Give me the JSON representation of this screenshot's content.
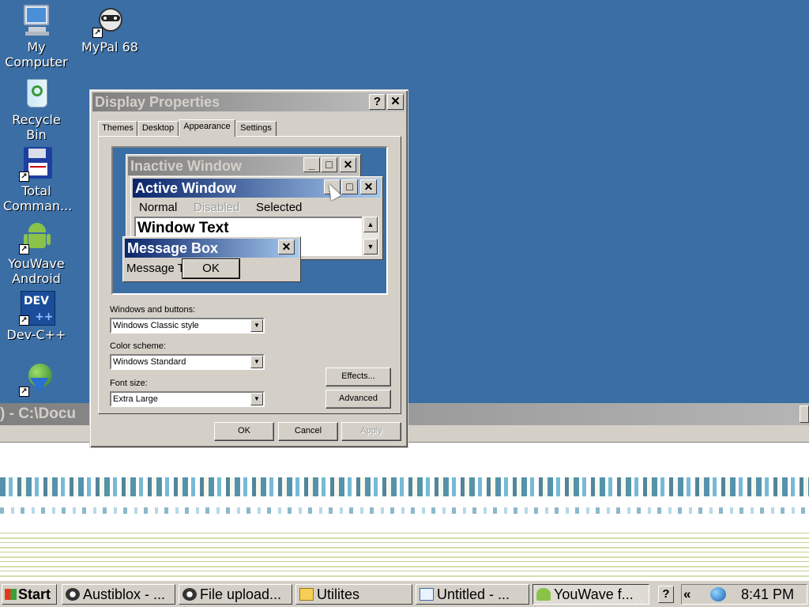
{
  "desktop": {
    "icons": [
      {
        "label": "My\nComputer",
        "icon": "my-computer-icon"
      },
      {
        "label": "MyPal 68",
        "icon": "mypal-raccoon-icon"
      },
      {
        "label": "Recycle Bin",
        "icon": "recycle-bin-icon"
      },
      {
        "label": "Total\nComman...",
        "icon": "floppy-disk-icon"
      },
      {
        "label": "YouWave\nAndroid",
        "icon": "android-icon"
      },
      {
        "label": "Dev-C++",
        "icon": "devcpp-icon"
      },
      {
        "label": "",
        "icon": "internet-download-icon"
      }
    ],
    "background_color": "#3a6ea5"
  },
  "background_window": {
    "title": ") - C:\\Docu"
  },
  "dialog": {
    "title": "Display Properties",
    "help_button": "?",
    "close_button": "✕",
    "tabs": [
      "Themes",
      "Desktop",
      "Appearance",
      "Settings"
    ],
    "active_tab": "Appearance",
    "preview": {
      "inactive_title": "Inactive Window",
      "active_title": "Active Window",
      "menu_items": [
        "Normal",
        "Disabled",
        "Selected"
      ],
      "window_text": "Window Text",
      "message_box_title": "Message Box",
      "message_text": "Message Text",
      "ok_label": "OK"
    },
    "windows_and_buttons": {
      "label": "Windows and buttons:",
      "value": "Windows Classic style"
    },
    "color_scheme": {
      "label": "Color scheme:",
      "value": "Windows Standard"
    },
    "font_size": {
      "label": "Font size:",
      "value": "Extra Large"
    },
    "effects_label": "Effects...",
    "advanced_label": "Advanced",
    "ok_label": "OK",
    "cancel_label": "Cancel",
    "apply_label": "Apply"
  },
  "taskbar": {
    "start_label": "Start",
    "tasks": [
      {
        "label": "Austiblox - ...",
        "icon": "raccoon-icon"
      },
      {
        "label": "File upload...",
        "icon": "raccoon-icon"
      },
      {
        "label": "Utilites",
        "icon": "folder-icon"
      },
      {
        "label": "Untitled - ...",
        "icon": "notepad-icon"
      },
      {
        "label": "YouWave f...",
        "icon": "android-icon"
      }
    ],
    "help_label": "?",
    "tray_chevron": "«",
    "clock": "8:41 PM"
  }
}
